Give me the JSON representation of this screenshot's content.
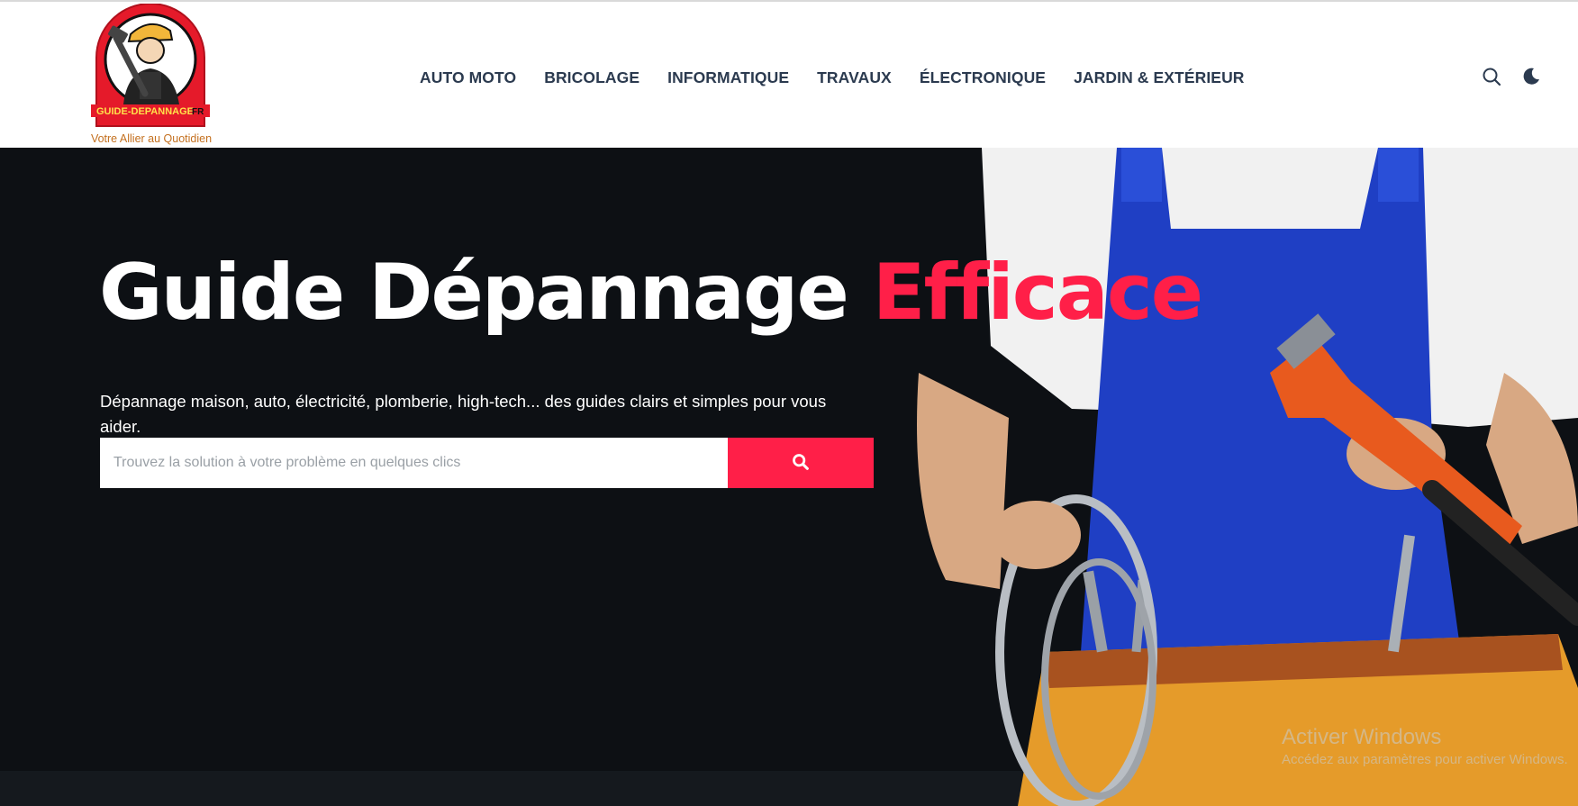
{
  "header": {
    "logo_text": "GUIDE-DEPANNAGE",
    "logo_suffix": "FR",
    "tagline": "Votre Allier au Quotidien",
    "nav": [
      {
        "label": "AUTO MOTO"
      },
      {
        "label": "BRICOLAGE"
      },
      {
        "label": "INFORMATIQUE"
      },
      {
        "label": "TRAVAUX"
      },
      {
        "label": "ÉLECTRONIQUE"
      },
      {
        "label": "JARDIN & EXTÉRIEUR"
      }
    ],
    "icons": [
      "search-icon",
      "moon-icon"
    ]
  },
  "hero": {
    "title_main": "Guide Dépannage ",
    "title_accent": "Efficace",
    "subtitle": "Dépannage maison, auto, électricité, plomberie, high-tech... des guides clairs et simples pour vous aider.",
    "search_placeholder": "Trouvez la solution à votre problème en quelques clics",
    "search_value": ""
  },
  "watermark": {
    "title": "Activer Windows",
    "subtitle": "Accédez aux paramètres pour activer Windows."
  },
  "colors": {
    "accent": "#ff1f48",
    "hero_bg": "#0d1014",
    "nav_text": "#2b3a4f",
    "tagline": "#c4701f",
    "overall_blue": "#1f3fc4",
    "wrench_orange": "#e85a1e"
  }
}
